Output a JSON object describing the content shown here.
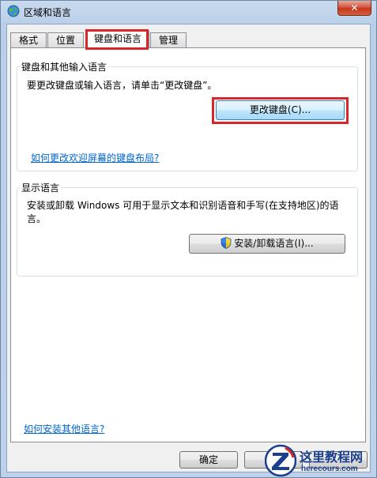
{
  "window": {
    "title": "区域和语言",
    "close_symbol": "✕"
  },
  "tabs": [
    {
      "label": "格式",
      "active": false
    },
    {
      "label": "位置",
      "active": false
    },
    {
      "label": "键盘和语言",
      "active": true
    },
    {
      "label": "管理",
      "active": false
    }
  ],
  "keyboard_group": {
    "title": "键盘和其他输入语言",
    "description": "要更改键盘或输入语言，请单击“更改键盘”。",
    "change_button": "更改键盘(C)...",
    "welcome_link": "如何更改欢迎屏幕的键盘布局?"
  },
  "display_group": {
    "title": "显示语言",
    "description_line1": "安装或卸载 Windows 可用于显示文本和识别语音和手写(在支持地区)的语",
    "description_line2": "言。",
    "install_button": "安装/卸载语言(I)..."
  },
  "footer": {
    "help_link": "如何安装其他语言?",
    "ok_button": "确定"
  },
  "watermark": {
    "title": "这里教程网",
    "url": "herecours.com"
  },
  "colors": {
    "highlight": "#d8262b",
    "link": "#0066cc",
    "watermark": "#1c3f8c"
  }
}
